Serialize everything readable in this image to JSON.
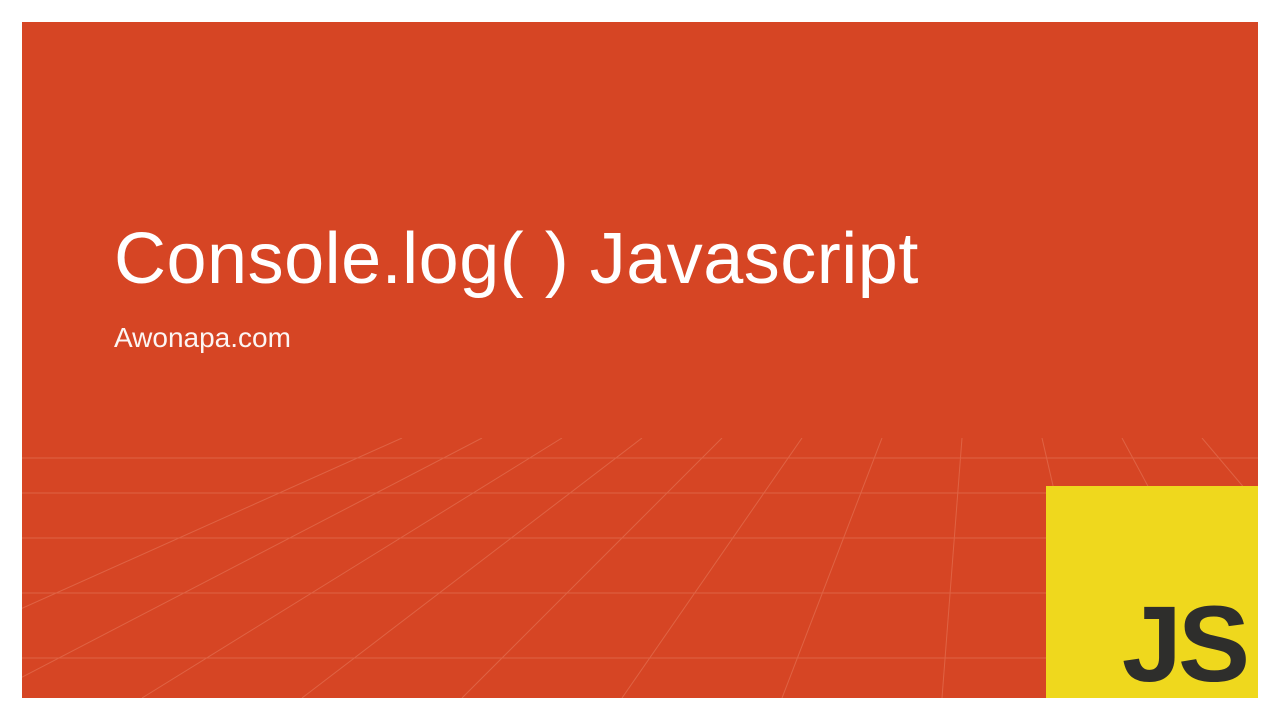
{
  "slide": {
    "title": "Console.log( ) Javascript",
    "subtitle": "Awonapa.com"
  },
  "logo": {
    "text": "JS"
  },
  "colors": {
    "background": "#d64524",
    "text": "#ffffff",
    "logo_bg": "#efd81d",
    "logo_fg": "#2e2e2c"
  }
}
